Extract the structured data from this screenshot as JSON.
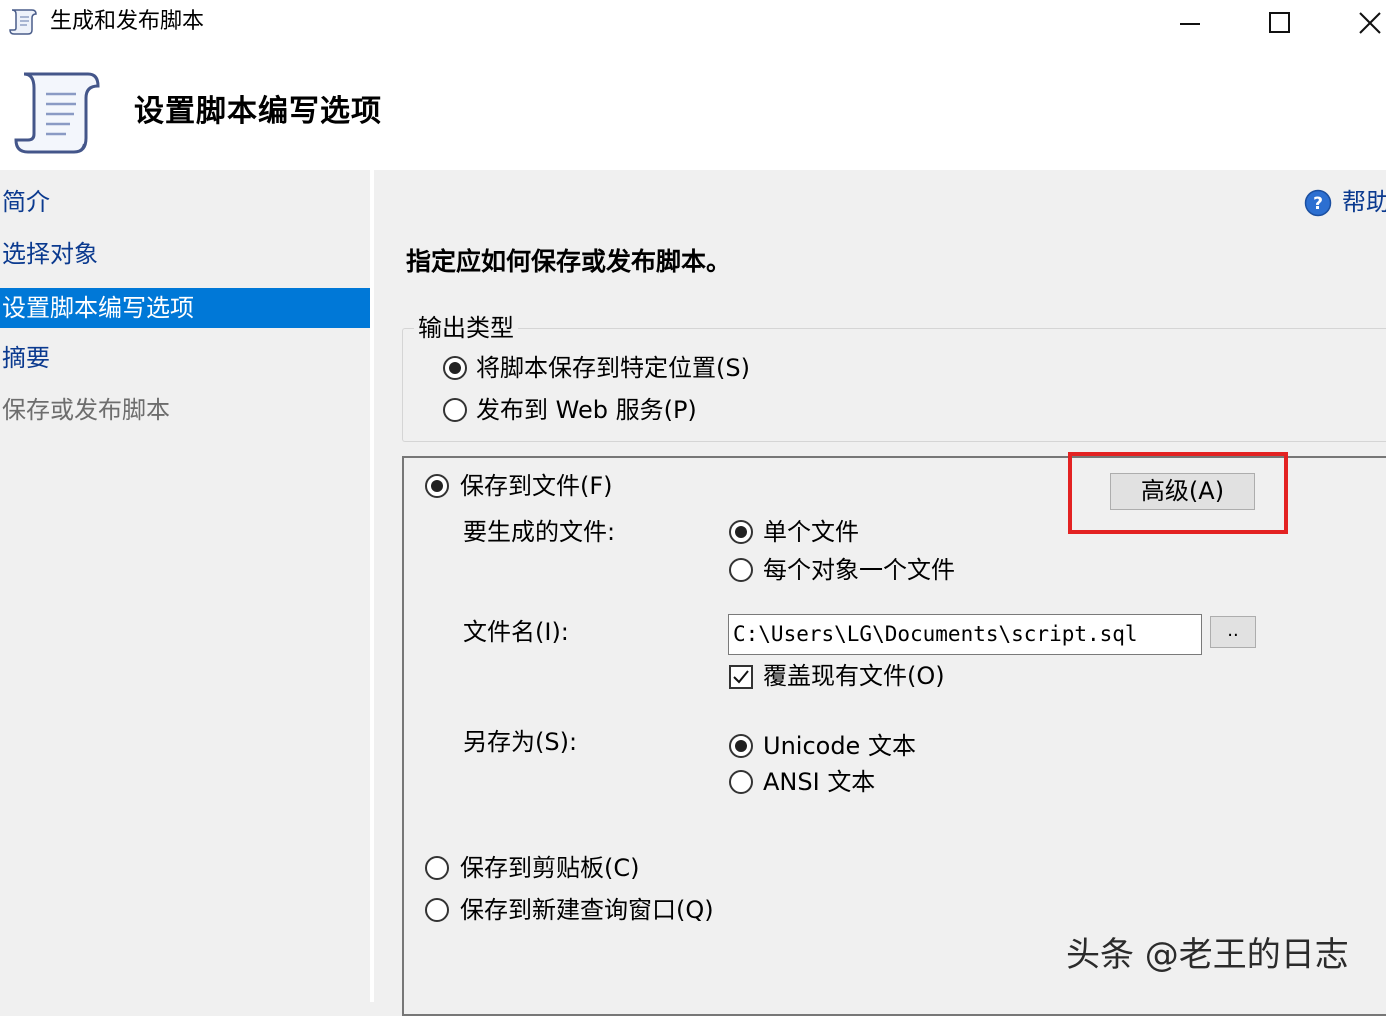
{
  "window": {
    "title": "生成和发布脚本"
  },
  "header": {
    "title": "设置脚本编写选项"
  },
  "nav": {
    "items": [
      {
        "label": "简介",
        "state": "normal"
      },
      {
        "label": "选择对象",
        "state": "normal"
      },
      {
        "label": "设置脚本编写选项",
        "state": "active"
      },
      {
        "label": "摘要",
        "state": "normal"
      },
      {
        "label": "保存或发布脚本",
        "state": "disabled"
      }
    ]
  },
  "main": {
    "help_label": "帮助",
    "instruction": "指定应如何保存或发布脚本。",
    "output_type": {
      "legend": "输出类型",
      "options": [
        {
          "label": "将脚本保存到特定位置(S)",
          "selected": true
        },
        {
          "label": "发布到 Web 服务(P)",
          "selected": false
        }
      ]
    },
    "save_to_file": {
      "label": "保存到文件(F)",
      "selected": true,
      "advanced_button": "高级(A)",
      "files_to_generate": {
        "label": "要生成的文件:",
        "options": [
          {
            "label": "单个文件",
            "selected": true
          },
          {
            "label": "每个对象一个文件",
            "selected": false
          }
        ]
      },
      "filename": {
        "label": "文件名(I):",
        "value": "C:\\Users\\LG\\Documents\\script.sql",
        "browse_label": ".."
      },
      "overwrite": {
        "label": "覆盖现有文件(O)",
        "checked": true
      },
      "save_as": {
        "label": "另存为(S):",
        "options": [
          {
            "label": "Unicode 文本",
            "selected": true
          },
          {
            "label": "ANSI 文本",
            "selected": false
          }
        ]
      }
    },
    "save_to_clipboard": {
      "label": "保存到剪贴板(C)",
      "selected": false
    },
    "save_to_query_window": {
      "label": "保存到新建查询窗口(Q)",
      "selected": false
    }
  },
  "watermark": "头条 @老王的日志",
  "colors": {
    "nav_active_bg": "#0078d7",
    "nav_link": "#0b3a8f",
    "highlight_border": "#e32222",
    "background": "#f0f0f0"
  },
  "icons": {
    "app": "script-scroll-icon",
    "help": "help-question-icon"
  }
}
